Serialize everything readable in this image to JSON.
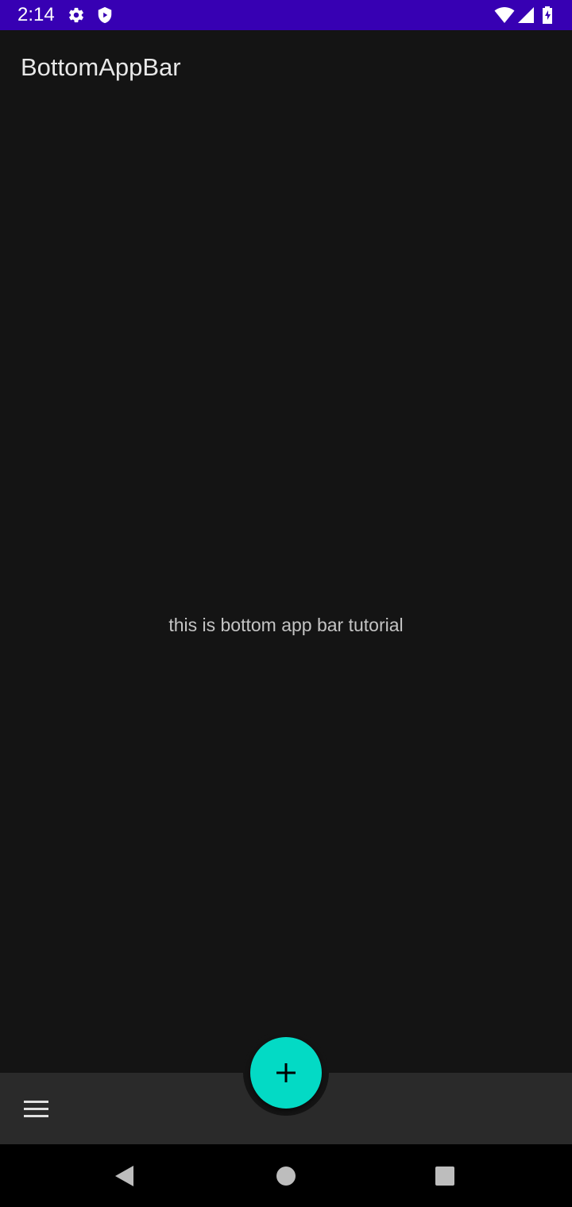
{
  "status_bar": {
    "time": "2:14",
    "icons": [
      "settings-icon",
      "shield-icon",
      "wifi-icon",
      "cellular-signal-icon",
      "battery-charging-icon"
    ],
    "background_color": "#3700b3"
  },
  "app_bar": {
    "title": "BottomAppBar"
  },
  "main": {
    "body_text": "this is bottom app bar tutorial"
  },
  "bottom_app_bar": {
    "navigation_icon": "menu-icon",
    "fab_icon": "add-icon",
    "fab_color": "#03dac5",
    "bar_color": "#2a2a2a"
  },
  "navigation_bar": {
    "buttons": [
      "back-icon",
      "home-icon",
      "recents-icon"
    ]
  },
  "theme": {
    "background": "#141414",
    "text_primary": "#e8e8e8",
    "text_secondary": "#c4c4c4"
  }
}
